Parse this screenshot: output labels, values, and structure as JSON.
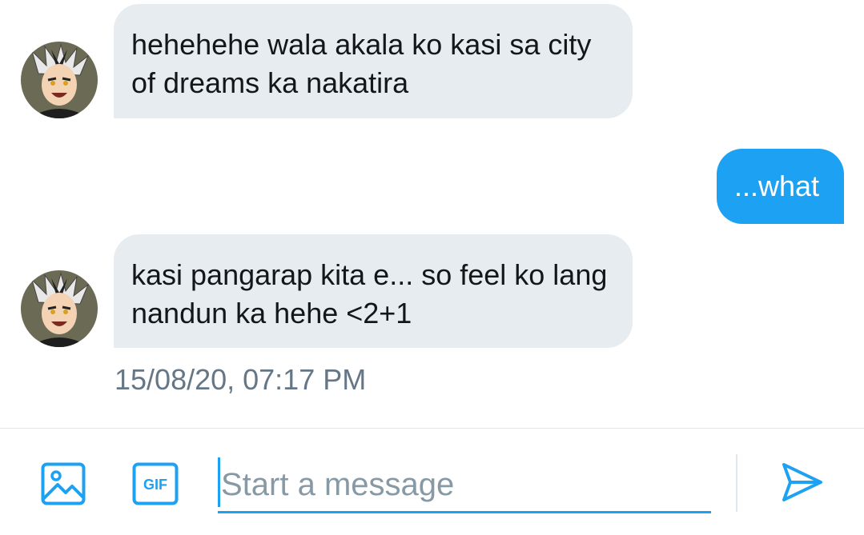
{
  "conversation": {
    "messages": [
      {
        "direction": "received",
        "text": "hehehehe wala akala ko kasi sa city of dreams ka nakatira"
      },
      {
        "direction": "sent",
        "text": "...what"
      },
      {
        "direction": "received",
        "text": "kasi pangarap kita e... so feel ko lang nandun ka hehe <2+1"
      }
    ],
    "timestamp": "15/08/20, 07:17 PM"
  },
  "composer": {
    "placeholder": "Start a message",
    "value": "",
    "gif_label": "GIF",
    "icons": [
      "image-icon",
      "gif-icon",
      "send-icon"
    ]
  },
  "colors": {
    "accent": "#1da1f2",
    "received_bubble": "#e6ecf0",
    "timestamp_text": "#657786"
  }
}
